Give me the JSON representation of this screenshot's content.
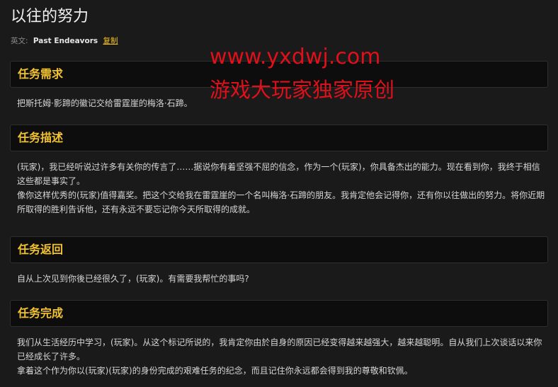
{
  "page": {
    "title": "以往的努力",
    "english_label": "英文:",
    "english_name": "Past Endeavors",
    "copy_label": "复制"
  },
  "watermark": {
    "url": "www.yxdwj.com",
    "text": "游戏大玩家独家原创"
  },
  "sections": [
    {
      "heading": "任务需求",
      "paragraphs": [
        "把斯托姆·影蹄的徽记交给雷霆崖的梅洛·石蹄。"
      ]
    },
    {
      "heading": "任务描述",
      "paragraphs": [
        "(玩家)，我已经听说过许多有关你的传言了……据说你有着坚强不屈的信念，作为一个(玩家)，你具备杰出的能力。现在看到你，我终于相信这些都是事实了。",
        "像你这样优秀的(玩家)值得嘉奖。把这个交给我在雷霆崖的一个名叫梅洛·石蹄的朋友。我肯定他会记得你，还有你以往做出的努力。将你近期所取得的胜利告诉他，还有永远不要忘记你今天所取得的成就。"
      ]
    },
    {
      "heading": "任务返回",
      "paragraphs": [
        "自从上次见到你後已经很久了，(玩家)。有需要我帮忙的事吗?"
      ]
    },
    {
      "heading": "任务完成",
      "paragraphs": [
        "我们从生活经历中学习，(玩家)。从这个标记所说的，我肯定你由於自身的原因已经变得越来越强大，越来越聪明。自从我们上次谈话以来你已经成长了许多。",
        "拿着这个作为你以(玩家)(玩家)的身份完成的艰难任务的纪念，而且记住你永远都会得到我的尊敬和钦佩。"
      ]
    }
  ]
}
